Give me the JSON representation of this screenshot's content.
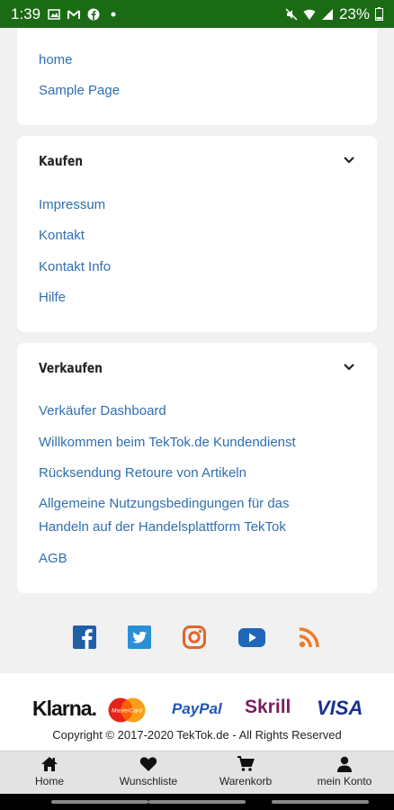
{
  "status_bar": {
    "time": "1:39",
    "battery": "23%"
  },
  "card_top": {
    "links": [
      "home",
      "Sample Page"
    ]
  },
  "card_kaufen": {
    "title": "Kaufen",
    "links": [
      "Impressum",
      "Kontakt",
      "Kontakt Info",
      "Hilfe"
    ]
  },
  "card_verkaufen": {
    "title": "Verkaufen",
    "links": [
      "Verkäufer Dashboard",
      "Willkommen beim TekTok.de Kundendienst",
      "Rücksendung Retoure von Artikeln",
      "Allgemeine Nutzungsbedingungen für das",
      "Handeln auf der Handelsplattform TekTok",
      "AGB"
    ]
  },
  "social": [
    "facebook-icon",
    "twitter-icon",
    "instagram-icon",
    "youtube-icon",
    "rss-icon"
  ],
  "payments": {
    "klarna": "Klarna.",
    "mastercard": "MasterCard",
    "paypal": "PayPal",
    "skrill": "Skrill",
    "visa": "VISA"
  },
  "copyright": "Copyright © 2017-2020 TekTok.de - All Rights Reserved",
  "bottom_nav": {
    "home": "Home",
    "wishlist": "Wunschliste",
    "cart": "Warenkorb",
    "account": "mein Konto"
  },
  "colors": {
    "statusbar": "#1b6b14",
    "link": "#2f6fb0",
    "facebook": "#1f5fa8",
    "twitter": "#2a8fd6",
    "instagram": "#e0662a",
    "youtube": "#1f66b8",
    "rss": "#ee7a2b"
  }
}
